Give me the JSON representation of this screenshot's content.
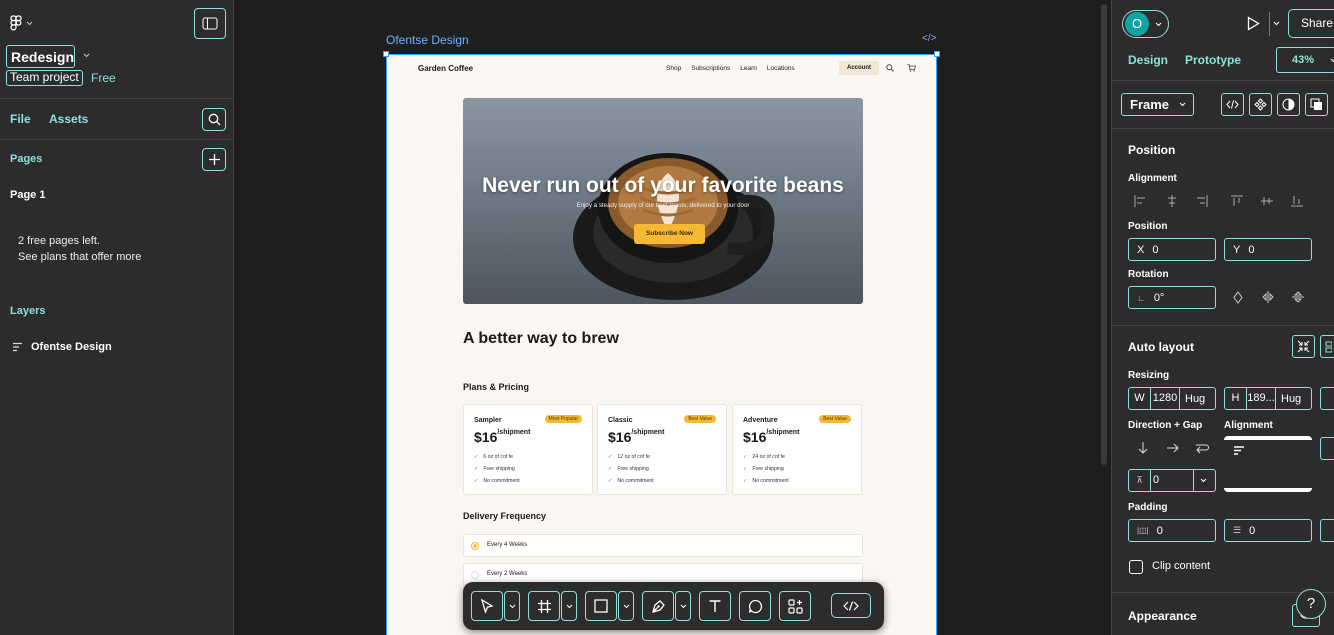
{
  "left": {
    "file_name": "Redesign",
    "team_project": "Team project",
    "plan": "Free",
    "tabs": {
      "file": "File",
      "assets": "Assets"
    },
    "pages_title": "Pages",
    "page1": "Page 1",
    "free_pages_line1": "2 free pages left.",
    "free_pages_line2": "See plans that offer more",
    "layers_title": "Layers",
    "layer1": "Ofentse Design"
  },
  "canvas": {
    "frame_label": "Ofentse Design",
    "site": {
      "brand": "Garden Coffee",
      "nav": [
        "Shop",
        "Subscriptions",
        "Learn",
        "Locations"
      ],
      "account": "Account",
      "hero_title": "Never run out of your favorite beans",
      "hero_sub": "Enjoy a steady supply of our best roasts, delivered to your door",
      "hero_button": "Subscribe Now",
      "section_title": "A better way to brew",
      "plans_title": "Plans & Pricing",
      "plans": [
        {
          "name": "Sampler",
          "badge": "Most Popular",
          "price": "$16",
          "per": "/shipment",
          "features": [
            "6 oz of cof fe",
            "Free shipping",
            "No commitment"
          ]
        },
        {
          "name": "Classic",
          "badge": "Best Value",
          "price": "$16",
          "per": "/shipment",
          "features": [
            "12 oz of cof fe",
            "Free shipping",
            "No commitment"
          ]
        },
        {
          "name": "Adventure",
          "badge": "Best Value",
          "price": "$16",
          "per": "/shipment",
          "features": [
            "24 oz of cof fe",
            "Free shipping",
            "No commitment"
          ]
        }
      ],
      "delivery_title": "Delivery Frequency",
      "delivery_options": [
        "Every 4 Weeks",
        "Every 2 Weeks"
      ]
    }
  },
  "right": {
    "avatar_initial": "O",
    "share": "Share",
    "tabs": {
      "design": "Design",
      "prototype": "Prototype"
    },
    "zoom": "43%",
    "frame_dropdown": "Frame",
    "position_title": "Position",
    "alignment_label": "Alignment",
    "position_label": "Position",
    "x_label": "X",
    "x_value": "0",
    "y_label": "Y",
    "y_value": "0",
    "rotation_label": "Rotation",
    "rotation_value": "0°",
    "auto_layout_title": "Auto layout",
    "resizing_label": "Resizing",
    "w_label": "W",
    "w_value": "1280",
    "w_mode": "Hug",
    "h_label": "H",
    "h_value": "189...",
    "h_mode": "Hug",
    "direction_gap_label": "Direction + Gap",
    "alignment2_label": "Alignment",
    "gap_value": "0",
    "padding_label": "Padding",
    "pad_h_value": "0",
    "pad_v_value": "0",
    "clip_content": "Clip content",
    "appearance_title": "Appearance"
  },
  "colors": {
    "accent": "#8fe0da",
    "selection": "#2fa4ff",
    "badge": "#f5b935",
    "panel": "#2c2c2c",
    "canvas": "#1e1e1e"
  }
}
